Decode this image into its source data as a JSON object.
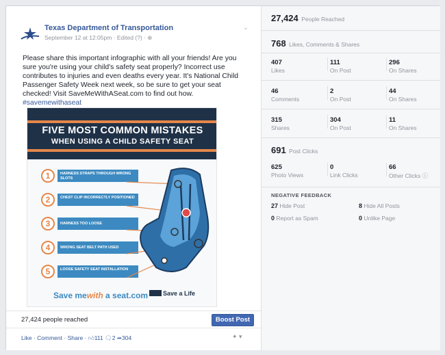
{
  "post": {
    "page_name": "Texas Department of Transportation",
    "meta": "September 12 at 12:05pm · Edited (?) · ⊕",
    "text_main": "Please share this important infographic with all your friends! Are you sure you're using your child's safety seat properly? Incorrect use contributes to injuries and even deaths every year. It's National Child Passenger Safety Week next week, so be sure to get your seat checked! Visit SaveMeWithASeat.com to find out how.",
    "hashtag": "#savemewithaseat",
    "infographic": {
      "title": "FIVE MOST COMMON MISTAKES",
      "subtitle": "WHEN USING A CHILD SAFETY SEAT",
      "mistakes": [
        {
          "num": "1",
          "label": "HARNESS STRAPS THROUGH WRONG SLOTS"
        },
        {
          "num": "2",
          "label": "CHEST CLIP INCORRECTLY POSITIONED"
        },
        {
          "num": "3",
          "label": "HARNESS TOO LOOSE"
        },
        {
          "num": "4",
          "label": "WRONG SEAT BELT PATH USED"
        },
        {
          "num": "5",
          "label": "LOOSE SAFETY SEAT INSTALLATION"
        }
      ],
      "brand_a": "Save me",
      "brand_b": "with",
      "brand_c": " a seat.com",
      "brand_right": "Save a Life"
    },
    "reached": "27,424 people reached",
    "boost_label": "Boost Post",
    "actions": {
      "like": "Like",
      "comment": "Comment",
      "share": "Share",
      "likes_count": "111",
      "comments_count": "2",
      "shares_count": "304"
    }
  },
  "insights": {
    "reached_value": "27,424",
    "reached_label": "People Reached",
    "engagement_value": "768",
    "engagement_label": "Likes, Comments & Shares",
    "rows": [
      {
        "total": "407",
        "total_label": "Likes",
        "on_post": "111",
        "on_post_label": "On Post",
        "on_shares": "296",
        "on_shares_label": "On Shares"
      },
      {
        "total": "46",
        "total_label": "Comments",
        "on_post": "2",
        "on_post_label": "On Post",
        "on_shares": "44",
        "on_shares_label": "On Shares"
      },
      {
        "total": "315",
        "total_label": "Shares",
        "on_post": "304",
        "on_post_label": "On Post",
        "on_shares": "11",
        "on_shares_label": "On Shares"
      }
    ],
    "clicks_value": "691",
    "clicks_label": "Post Clicks",
    "clicks": {
      "photo_views": "625",
      "photo_views_label": "Photo Views",
      "link_clicks": "0",
      "link_clicks_label": "Link Clicks",
      "other_clicks": "66",
      "other_clicks_label": "Other Clicks"
    },
    "negative_title": "NEGATIVE FEEDBACK",
    "negative": {
      "hide_post_value": "27",
      "hide_post_label": "Hide Post",
      "hide_all_value": "8",
      "hide_all_label": "Hide All Posts",
      "spam_value": "0",
      "spam_label": "Report as Spam",
      "unlike_value": "0",
      "unlike_label": "Unlike Page"
    }
  },
  "colors": {
    "link_blue": "#365899",
    "boost_blue": "#4267b2",
    "infographic_navy": "#1f3147",
    "infographic_orange": "#e5874a",
    "infographic_blue": "#3c8ac1"
  }
}
